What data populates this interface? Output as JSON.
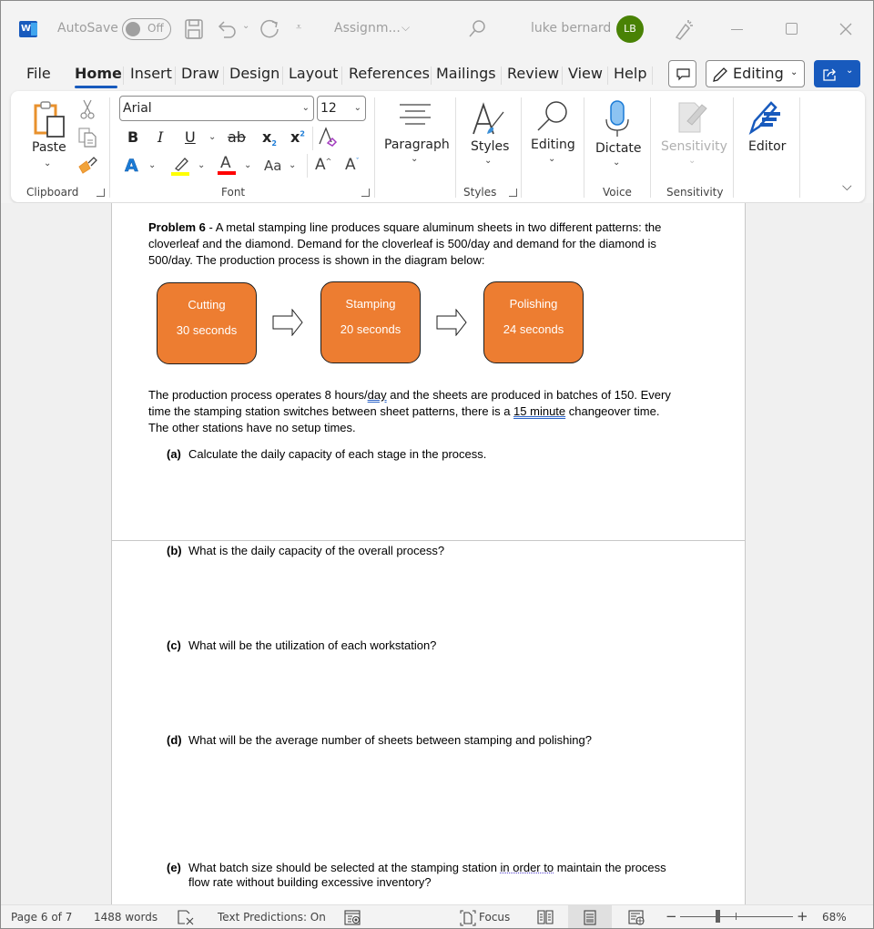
{
  "titlebar": {
    "app_icon": "word-logo-icon",
    "autosave_label": "AutoSave",
    "autosave_state": "Off",
    "doc_title": "Assignm...",
    "user_name": "luke bernard",
    "user_initials": "LB",
    "avatar_color": "#498205"
  },
  "menu": {
    "tabs": [
      "File",
      "Home",
      "Insert",
      "Draw",
      "Design",
      "Layout",
      "References",
      "Mailings",
      "Review",
      "View",
      "Help"
    ],
    "active_tab": "Home",
    "editing_label": "Editing",
    "accent": "#185abd"
  },
  "ribbon": {
    "clipboard": {
      "paste_label": "Paste",
      "group_label": "Clipboard"
    },
    "font": {
      "font_name": "Arial",
      "font_size": "12",
      "group_label": "Font",
      "bold": "B",
      "italic": "I",
      "underline": "U",
      "strike": "ab",
      "subscript": "x",
      "superscript": "x",
      "change_case": "Aa",
      "grow": "A",
      "shrink": "A",
      "highlight_color": "#ffff00",
      "font_color": "#ff0000"
    },
    "paragraph_label": "Paragraph",
    "styles_label": "Styles",
    "styles_group_label": "Styles",
    "editing_label": "Editing",
    "dictate_label": "Dictate",
    "voice_group_label": "Voice",
    "sensitivity_label": "Sensitivity",
    "sensitivity_group_label": "Sensitivity",
    "editor_label": "Editor"
  },
  "document": {
    "problem_label": "Problem 6",
    "intro_line1": " - A metal stamping line produces square aluminum sheets in two different patterns: the",
    "intro_line2": "cloverleaf and the diamond.  Demand for the cloverleaf is 500/day and demand for the diamond is",
    "intro_line3": "500/day.   The production process is shown in the diagram below:",
    "process_steps": [
      {
        "name": "Cutting",
        "time": "30 seconds"
      },
      {
        "name": "Stamping",
        "time": "20 seconds"
      },
      {
        "name": "Polishing",
        "time": "24 seconds"
      }
    ],
    "box_color": "#ed7d31",
    "para2_line1_a": "The production process operates 8 hours/",
    "para2_line1_b": "day",
    "para2_line1_c": " and the sheets are produced in batches of 150.  Every",
    "para2_line2_a": "time the stamping station switches between sheet patterns, there is a ",
    "para2_line2_b": "15 minute",
    "para2_line2_c": " changeover time.",
    "para2_line3": "The other stations have no setup times.",
    "questions": [
      {
        "label": "(a)",
        "text": "Calculate the daily capacity of each stage in the process."
      },
      {
        "label": "(b)",
        "text": "What is the daily capacity of the overall process?"
      },
      {
        "label": "(c)",
        "text": "What will be the utilization of each workstation?"
      },
      {
        "label": "(d)",
        "text": "What will be the average number of sheets between stamping and polishing?"
      },
      {
        "label": "(e)",
        "text_a": "What batch size should be selected at the stamping station ",
        "text_b": "in order to",
        "text_c": " maintain the process",
        "text_line2": "flow rate without building excessive inventory?"
      }
    ]
  },
  "statusbar": {
    "page": "Page 6 of 7",
    "words": "1488 words",
    "text_predictions": "Text Predictions: On",
    "focus": "Focus",
    "zoom_percent": "68%",
    "zoom_value": 68
  }
}
